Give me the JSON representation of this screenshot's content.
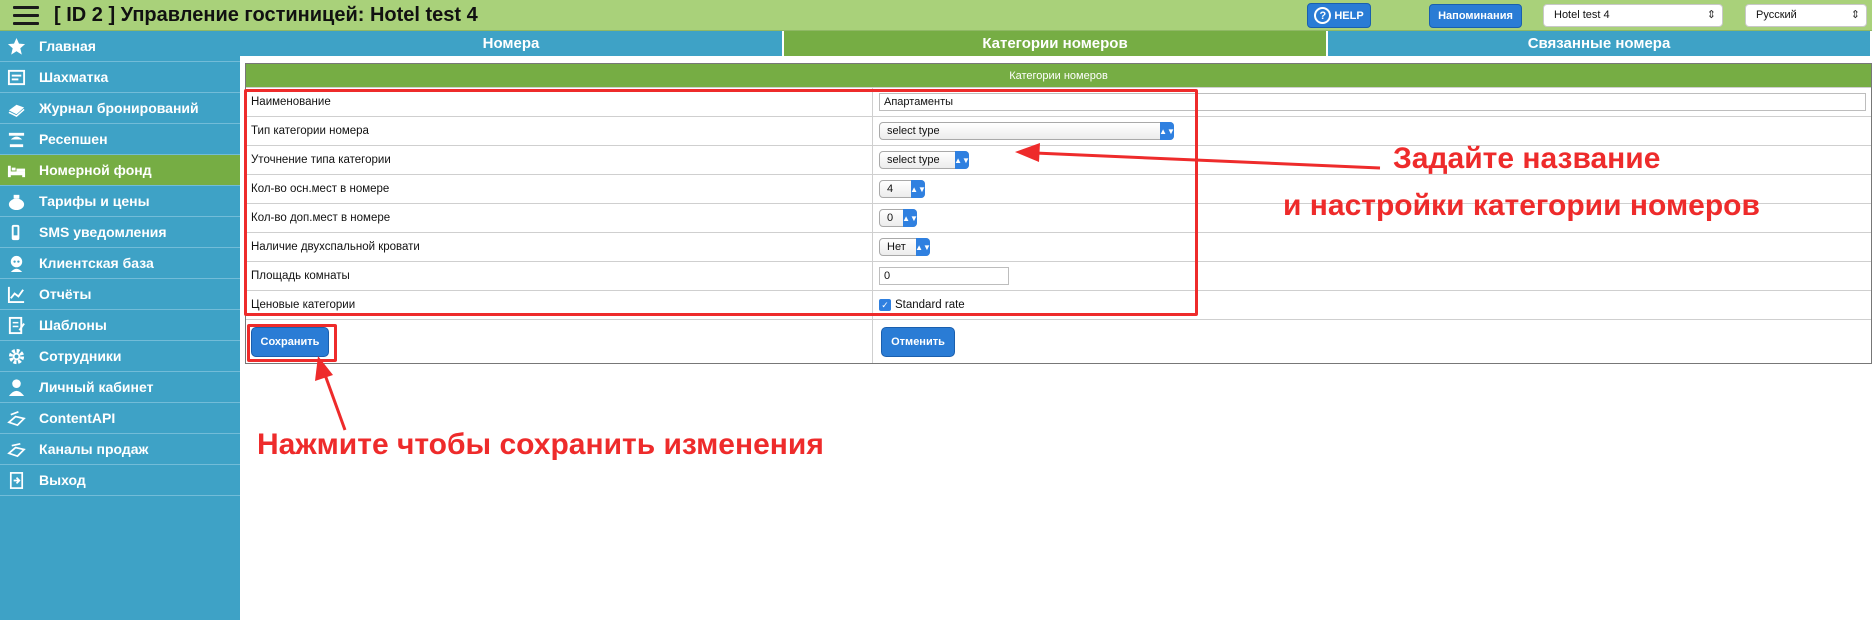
{
  "header": {
    "title": "[ ID 2 ] Управление гостиницей: Hotel test 4",
    "help_label": "HELP",
    "reminders_label": "Напоминания",
    "hotel_select": "Hotel test 4",
    "language_select": "Русский"
  },
  "sidebar": {
    "items": [
      {
        "label": "Главная",
        "icon": "star-icon"
      },
      {
        "label": "Шахматка",
        "icon": "grid-icon"
      },
      {
        "label": "Журнал бронирований",
        "icon": "book-icon"
      },
      {
        "label": "Ресепшен",
        "icon": "reception-icon"
      },
      {
        "label": "Номерной фонд",
        "icon": "bed-icon",
        "active": true
      },
      {
        "label": "Тарифы и цены",
        "icon": "money-bag-icon"
      },
      {
        "label": "SMS уведомления",
        "icon": "phone-icon"
      },
      {
        "label": "Клиентская база",
        "icon": "client-icon"
      },
      {
        "label": "Отчёты",
        "icon": "chart-icon"
      },
      {
        "label": "Шаблоны",
        "icon": "template-icon"
      },
      {
        "label": "Сотрудники",
        "icon": "gear-icon"
      },
      {
        "label": "Личный кабинет",
        "icon": "user-icon"
      },
      {
        "label": "ContentAPI",
        "icon": "api-icon"
      },
      {
        "label": "Каналы продаж",
        "icon": "channels-icon"
      },
      {
        "label": "Выход",
        "icon": "exit-icon"
      }
    ]
  },
  "tabs": [
    {
      "label": "Номера"
    },
    {
      "label": "Категории номеров",
      "active": true
    },
    {
      "label": "Связанные номера"
    }
  ],
  "form": {
    "header": "Категории номеров",
    "rows": {
      "name": {
        "label": "Наименование",
        "value": "Апартаменты"
      },
      "type": {
        "label": "Тип категории номера",
        "value": "select type"
      },
      "subtype": {
        "label": "Уточнение типа категории",
        "value": "select type"
      },
      "main_beds": {
        "label": "Кол-во осн.мест в номере",
        "value": "4"
      },
      "extra_beds": {
        "label": "Кол-во доп.мест в номере",
        "value": "0"
      },
      "double_bed": {
        "label": "Наличие двухспальной кровати",
        "value": "Нет"
      },
      "area": {
        "label": "Площадь комнаты",
        "value": "0"
      },
      "price_categories": {
        "label": "Ценовые категории",
        "option": "Standard rate",
        "checked": true
      }
    },
    "save_label": "Сохранить",
    "cancel_label": "Отменить"
  },
  "annotations": {
    "line1": "Задайте название",
    "line2": "и настройки категории номеров",
    "save_hint": "Нажмите чтобы сохранить изменения",
    "color": "#ee2b2b"
  },
  "colors": {
    "topbar": "#a9d17a",
    "sidebar": "#3ea2c6",
    "active": "#76ad44",
    "button": "#2a7cd5"
  }
}
